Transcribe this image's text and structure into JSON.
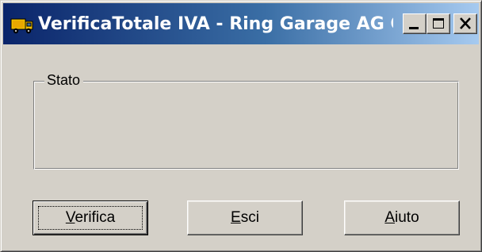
{
  "window": {
    "title": "VerificaTotale IVA - Ring Garage AG C...",
    "icon": "truck-icon"
  },
  "group": {
    "label": "Stato"
  },
  "buttons": {
    "verifica": {
      "mnemonic": "V",
      "rest": "erifica",
      "default": true
    },
    "esci": {
      "mnemonic": "E",
      "rest": "sci"
    },
    "aiuto": {
      "mnemonic": "A",
      "rest": "iuto"
    }
  },
  "colors": {
    "face": "#d4d0c8",
    "titlebar_start": "#0a246a",
    "titlebar_end": "#a6caf0"
  }
}
